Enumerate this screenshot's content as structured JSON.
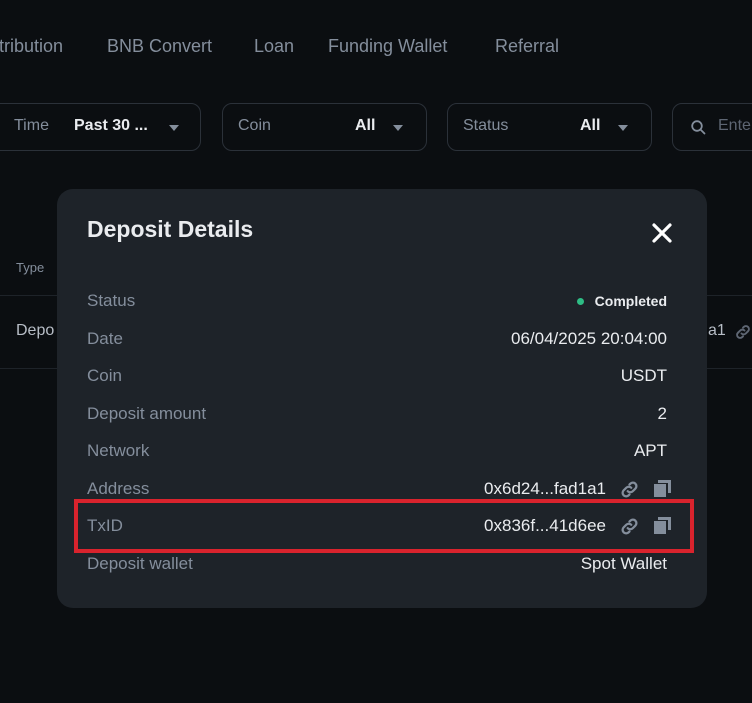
{
  "nav": {
    "tabs": [
      {
        "label": "tribution"
      },
      {
        "label": "BNB Convert"
      },
      {
        "label": "Loan"
      },
      {
        "label": "Funding Wallet"
      },
      {
        "label": "Referral"
      }
    ]
  },
  "filters": {
    "time": {
      "label": "Time",
      "value": "Past 30 ..."
    },
    "coin": {
      "label": "Coin",
      "value": "All"
    },
    "status": {
      "label": "Status",
      "value": "All"
    },
    "search": {
      "placeholder": "Ente"
    }
  },
  "background_table": {
    "column_type": "Type",
    "row_type": "Depo",
    "row_address_tail": "a1"
  },
  "modal": {
    "title": "Deposit Details",
    "rows": [
      {
        "label": "Status",
        "value": "Completed"
      },
      {
        "label": "Date",
        "value": "06/04/2025 20:04:00"
      },
      {
        "label": "Coin",
        "value": "USDT"
      },
      {
        "label": "Deposit amount",
        "value": "2"
      },
      {
        "label": "Network",
        "value": "APT"
      },
      {
        "label": "Address",
        "value": "0x6d24...fad1a1"
      },
      {
        "label": "TxID",
        "value": "0x836f...41d6ee"
      },
      {
        "label": "Deposit wallet",
        "value": "Spot Wallet"
      }
    ]
  },
  "icons": [
    "close-icon",
    "link-icon",
    "copy-icon",
    "search-icon",
    "chevron-down-icon"
  ],
  "colors": {
    "background": "#0b0e11",
    "modal": "#1e2329",
    "status_completed": "#2ebd85",
    "highlight": "#d9232d",
    "muted_text": "#848e9c"
  }
}
